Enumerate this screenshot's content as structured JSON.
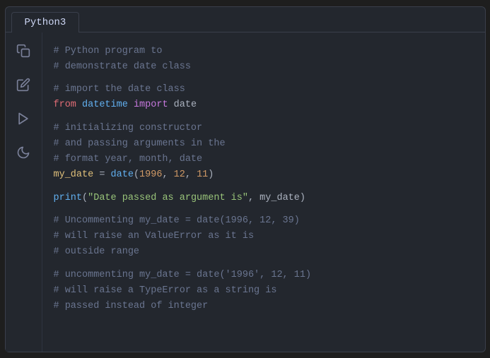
{
  "window": {
    "tab_label": "Python3"
  },
  "sidebar": {
    "icons": [
      {
        "name": "copy-icon",
        "symbol": "⧉"
      },
      {
        "name": "edit-icon",
        "symbol": "✏"
      },
      {
        "name": "run-icon",
        "symbol": "▶"
      },
      {
        "name": "moon-icon",
        "symbol": "☾"
      }
    ]
  },
  "code": {
    "lines": [
      {
        "type": "comment",
        "text": "# Python program to"
      },
      {
        "type": "comment",
        "text": "# demonstrate date class"
      },
      {
        "type": "blank"
      },
      {
        "type": "comment",
        "text": "# import the date class"
      },
      {
        "type": "import",
        "from": "from",
        "module": "datetime",
        "import": "import",
        "name": "date"
      },
      {
        "type": "blank"
      },
      {
        "type": "comment",
        "text": "# initializing constructor"
      },
      {
        "type": "comment",
        "text": "# and passing arguments in the"
      },
      {
        "type": "comment",
        "text": "# format year, month, date"
      },
      {
        "type": "assignment",
        "text": "my_date = date(1996, 12, 11)"
      },
      {
        "type": "blank"
      },
      {
        "type": "print",
        "text": "print(\"Date passed as argument is\", my_date)"
      },
      {
        "type": "blank"
      },
      {
        "type": "comment",
        "text": "# Uncommenting my_date = date(1996, 12, 39)"
      },
      {
        "type": "comment",
        "text": "# will raise an ValueError as it is"
      },
      {
        "type": "comment",
        "text": "# outside range"
      },
      {
        "type": "blank"
      },
      {
        "type": "comment",
        "text": "# uncommenting my_date = date('1996', 12, 11)"
      },
      {
        "type": "comment",
        "text": "# will raise a TypeError as a string is"
      },
      {
        "type": "comment",
        "text": "# passed instead of integer"
      }
    ]
  }
}
